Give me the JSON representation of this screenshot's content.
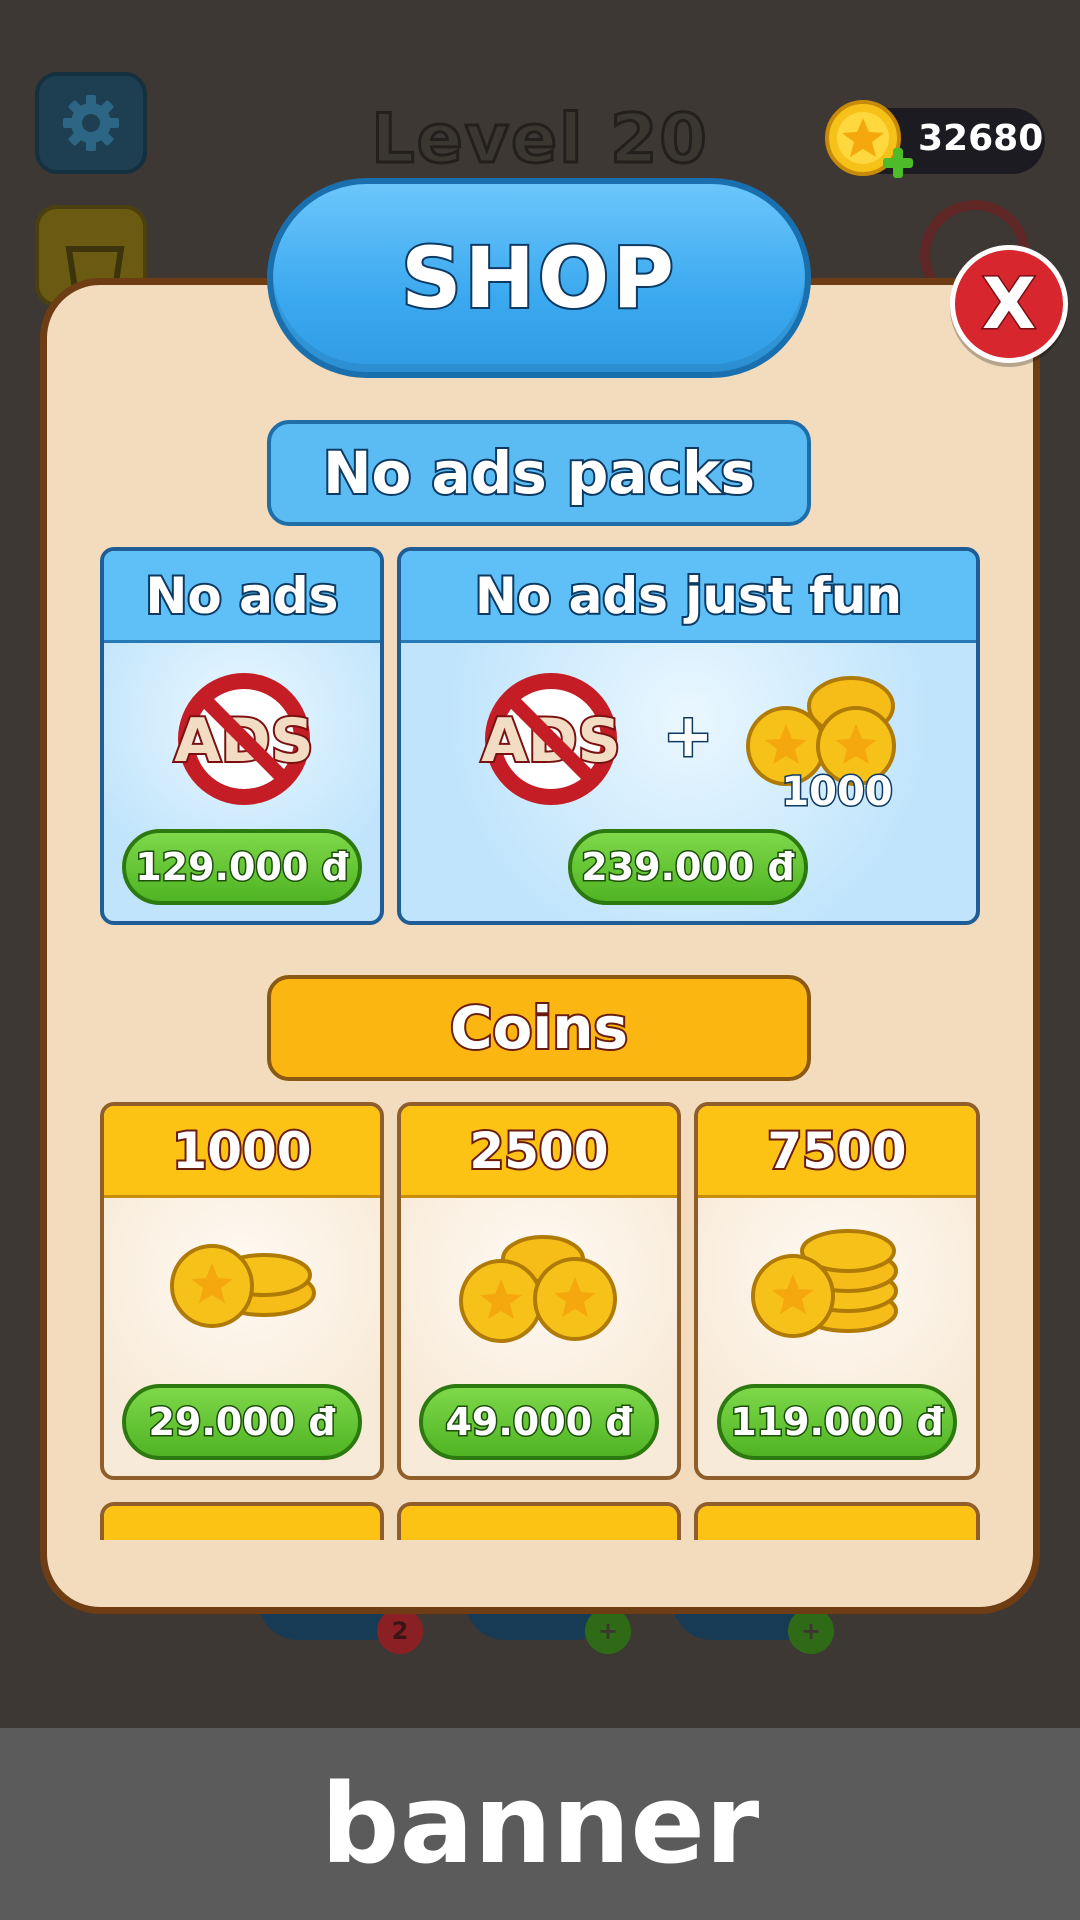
{
  "hud": {
    "level_title": "Level 20",
    "coins": "32680",
    "bottom_badge": "2"
  },
  "shop": {
    "title": "SHOP",
    "close_label": "X",
    "no_ads_section": "No ads packs",
    "no_ads_packs": [
      {
        "title": "No ads",
        "price": "129.000 đ"
      },
      {
        "title": "No ads just fun",
        "bonus_coins": "1000",
        "plus": "+",
        "price": "239.000 đ"
      }
    ],
    "coins_section": "Coins",
    "coin_packs": [
      {
        "amount": "1000",
        "price": "29.000 đ"
      },
      {
        "amount": "2500",
        "price": "49.000 đ"
      },
      {
        "amount": "7500",
        "price": "119.000 đ"
      }
    ],
    "ads_icon_text": "ADS"
  },
  "banner": {
    "label": "banner"
  },
  "colors": {
    "shop_blue": "#3ba9ef",
    "coins_gold": "#fbb612",
    "price_green": "#4fb423",
    "close_red": "#d8262e",
    "panel_cream": "#f3dcbd"
  }
}
